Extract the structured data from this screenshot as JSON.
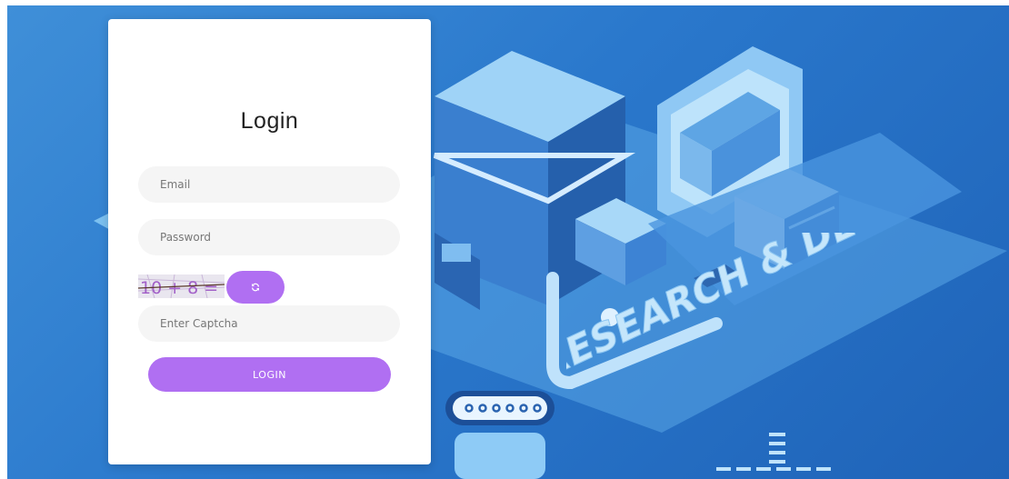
{
  "login": {
    "title": "Login",
    "email_placeholder": "Email",
    "password_placeholder": "Password",
    "captcha_placeholder": "Enter Captcha",
    "captcha_text": "10 + 8 =",
    "button_label": "LOGIN"
  },
  "banner": {
    "text": "RESEARCH & DEVELOPMENT"
  },
  "icons": {
    "refresh": "refresh-icon",
    "envelope": "envelope-icon"
  },
  "colors": {
    "accent": "#b06ff2",
    "background": "#2a78cc",
    "card": "#ffffff",
    "field": "#f5f5f5"
  }
}
